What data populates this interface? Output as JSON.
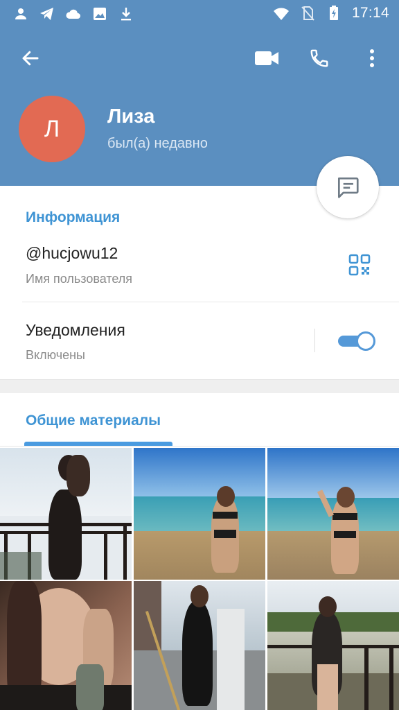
{
  "status_bar": {
    "time": "17:14",
    "left_icons": [
      "person-icon",
      "telegram-icon",
      "cloud-icon",
      "image-icon",
      "download-icon"
    ],
    "right_icons": [
      "wifi-icon",
      "no-sim-icon",
      "battery-charging-icon"
    ]
  },
  "header": {
    "back_icon": "arrow-left-icon",
    "actions": [
      "video-call-icon",
      "phone-icon",
      "more-vertical-icon"
    ],
    "avatar_letter": "Л",
    "name": "Лиза",
    "status": "был(а) недавно",
    "fab_icon": "message-icon"
  },
  "colors": {
    "header_bg": "#5b8fc0",
    "accent": "#3f94d4",
    "avatar_bg": "#e26a53",
    "toggle": "#5599d8"
  },
  "info": {
    "title": "Информация",
    "username": "@hucjowu12",
    "username_label": "Имя пользователя",
    "qr_icon": "qr-code-icon",
    "notifications_label": "Уведомления",
    "notifications_state": "Включены",
    "notifications_on": true
  },
  "media": {
    "title": "Общие материалы",
    "photos": [
      "photo-balcony-silhouette",
      "photo-beach-1",
      "photo-beach-2",
      "photo-selfie",
      "photo-stairs",
      "photo-lake-railing"
    ]
  }
}
